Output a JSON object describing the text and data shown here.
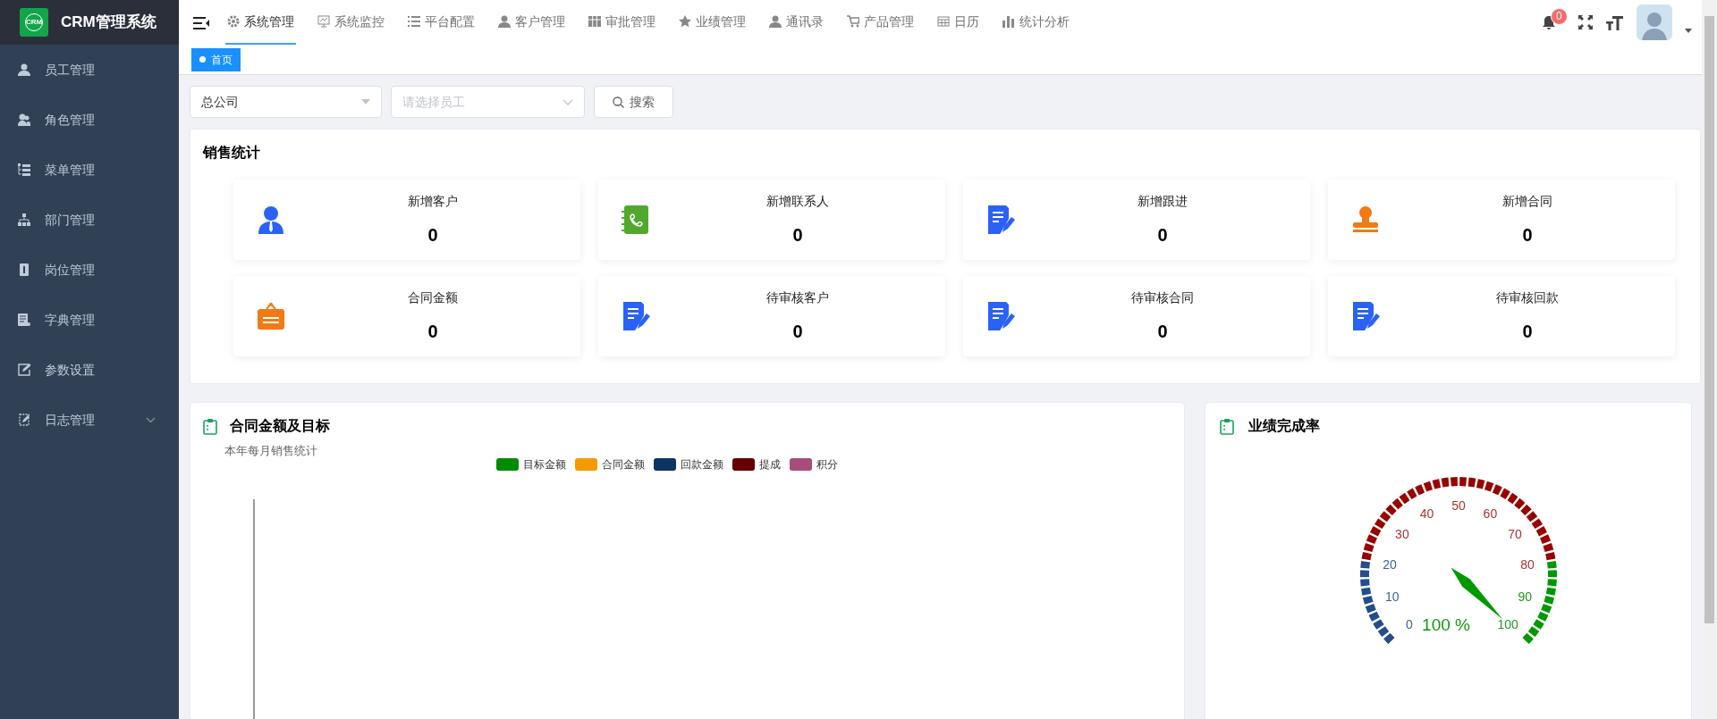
{
  "sidebar": {
    "logo": "CRM",
    "title": "CRM管理系统",
    "items": [
      {
        "label": "员工管理",
        "kind": "link"
      },
      {
        "label": "角色管理",
        "kind": "link"
      },
      {
        "label": "菜单管理",
        "kind": "link"
      },
      {
        "label": "部门管理",
        "kind": "link"
      },
      {
        "label": "岗位管理",
        "kind": "link"
      },
      {
        "label": "字典管理",
        "kind": "link"
      },
      {
        "label": "参数设置",
        "kind": "link"
      },
      {
        "label": "日志管理",
        "kind": "submenu",
        "expanded": false
      }
    ]
  },
  "topnav": {
    "items": [
      {
        "label": "系统管理",
        "selected": true
      },
      {
        "label": "系统监控",
        "selected": false
      },
      {
        "label": "平台配置",
        "selected": false
      },
      {
        "label": "客户管理",
        "selected": false
      },
      {
        "label": "审批管理",
        "selected": false
      },
      {
        "label": "业绩管理",
        "selected": false
      },
      {
        "label": "通讯录",
        "selected": false
      },
      {
        "label": "产品管理",
        "selected": false
      },
      {
        "label": "日历",
        "selected": false
      },
      {
        "label": "统计分析",
        "selected": false
      }
    ]
  },
  "header": {
    "notifications": "0"
  },
  "tags": [
    {
      "label": "首页",
      "selected": true
    }
  ],
  "filters": {
    "company": "总公司",
    "employee_placeholder": "请选择员工",
    "search_button": "搜索"
  },
  "sales_stats": {
    "title": "销售统计",
    "items": [
      {
        "label": "新增客户",
        "value": "0",
        "color": "#2962f5"
      },
      {
        "label": "新增联系人",
        "value": "0",
        "color": "#52a82f"
      },
      {
        "label": "新增跟进",
        "value": "0",
        "color": "#2962f5"
      },
      {
        "label": "新增合同",
        "value": "0",
        "color": "#f07a16"
      },
      {
        "label": "合同金额",
        "value": "0",
        "color": "#f07a16"
      },
      {
        "label": "待审核客户",
        "value": "0",
        "color": "#2962f5"
      },
      {
        "label": "待审核合同",
        "value": "0",
        "color": "#2962f5"
      },
      {
        "label": "待审核回款",
        "value": "0",
        "color": "#2962f5"
      }
    ]
  },
  "contract_chart": {
    "title": "合同金额及目标",
    "subtitle": "本年每月销售统计",
    "legend": [
      {
        "label": "目标金额",
        "color": "#008c00"
      },
      {
        "label": "合同金额",
        "color": "#f59a00"
      },
      {
        "label": "回款金额",
        "color": "#0c3661"
      },
      {
        "label": "提成",
        "color": "#660000"
      },
      {
        "label": "积分",
        "color": "#a64d79"
      }
    ]
  },
  "completion": {
    "title": "业绩完成率",
    "gauge": {
      "level": 1,
      "reading": "100 %",
      "ticks": [
        "0",
        "10",
        "20",
        "30",
        "40",
        "50",
        "60",
        "70",
        "80",
        "90",
        "100"
      ]
    }
  }
}
